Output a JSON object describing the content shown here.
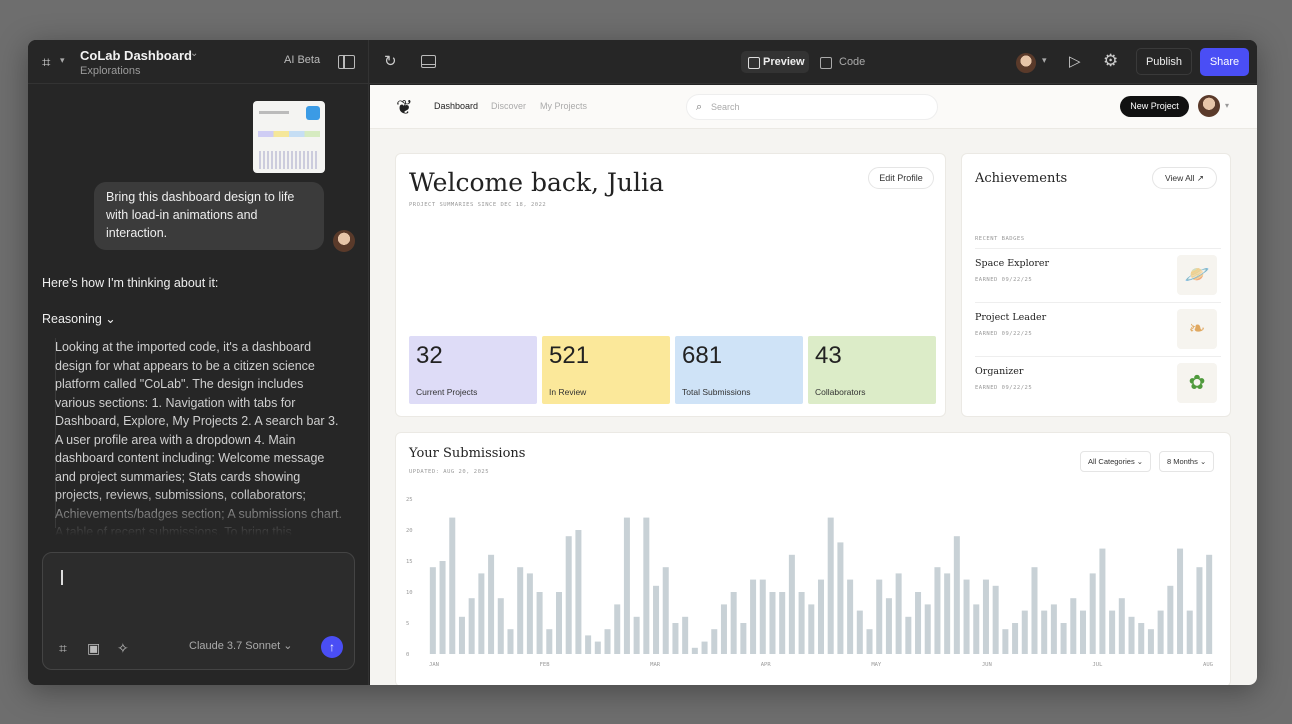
{
  "editor": {
    "title": "CoLab Dashboard",
    "subtitle": "Explorations",
    "ai_badge": "AI Beta"
  },
  "chat": {
    "user_message": "Bring this dashboard design to life with load-in animations and interaction.",
    "thinking_label": "Here's how I'm thinking about it:",
    "reasoning_label": "Reasoning",
    "reasoning_text": "Looking at the imported code, it's a dashboard design for what appears to be a citizen science platform called \"CoLab\". The design includes various sections: 1. Navigation with tabs for Dashboard, Explore, My Projects 2. A search bar 3. A user profile area with a dropdown 4. Main dashboard content including: Welcome message and project summaries; Stats cards showing projects, reviews, submissions, collaborators; Achievements/badges section; A submissions chart. A table of recent submissions. To bring this",
    "model": "Claude 3.7 Sonnet",
    "caret_down": "⌄"
  },
  "toolbar": {
    "preview": "Preview",
    "code": "Code",
    "publish": "Publish",
    "share": "Share"
  },
  "app": {
    "nav": {
      "tabs": [
        "Dashboard",
        "Discover",
        "My Projects"
      ],
      "search_placeholder": "Search",
      "new_project": "New Project"
    },
    "welcome": {
      "title": "Welcome back, Julia",
      "subtitle": "PROJECT SUMMARIES SINCE DEC 18, 2022",
      "edit_profile": "Edit Profile"
    },
    "stats": [
      {
        "value": "32",
        "label": "Current Projects",
        "color": "#dedcf7"
      },
      {
        "value": "521",
        "label": "In Review",
        "color": "#fbe89a"
      },
      {
        "value": "681",
        "label": "Total Submissions",
        "color": "#cfe3f7"
      },
      {
        "value": "43",
        "label": "Collaborators",
        "color": "#dcecc8"
      }
    ],
    "achievements": {
      "title": "Achievements",
      "view_all": "View All ↗",
      "recent_label": "RECENT BADGES",
      "badges": [
        {
          "name": "Space Explorer",
          "earned": "EARNED 09/22/25",
          "icon": "planet-icon"
        },
        {
          "name": "Project Leader",
          "earned": "EARNED 09/22/25",
          "icon": "leaf-icon"
        },
        {
          "name": "Organizer",
          "earned": "EARNED 09/22/25",
          "icon": "clover-icon"
        }
      ]
    },
    "submissions": {
      "title": "Your Submissions",
      "updated": "UPDATED: AUG 20, 2025",
      "category_select": "All Categories",
      "range_select": "8 Months"
    }
  },
  "chart_data": {
    "type": "bar",
    "ylim": [
      0,
      25
    ],
    "yticks": [
      "25",
      "20",
      "15",
      "10",
      "5",
      "0"
    ],
    "xticks": [
      "JAN",
      "FEB",
      "MAR",
      "APR",
      "MAY",
      "JUN",
      "JUL",
      "AUG"
    ],
    "color": "#c8d1d6",
    "values": [
      14,
      15,
      22,
      6,
      9,
      13,
      16,
      9,
      4,
      14,
      13,
      10,
      4,
      10,
      19,
      20,
      3,
      2,
      4,
      8,
      22,
      6,
      22,
      11,
      14,
      5,
      6,
      1,
      2,
      4,
      8,
      10,
      5,
      12,
      12,
      10,
      10,
      16,
      10,
      8,
      12,
      22,
      18,
      12,
      7,
      4,
      12,
      9,
      13,
      6,
      10,
      8,
      14,
      13,
      19,
      12,
      8,
      12,
      11,
      4,
      5,
      7,
      14,
      7,
      8,
      5,
      9,
      7,
      13,
      17,
      7,
      9,
      6,
      5,
      4,
      7,
      11,
      17,
      7,
      14,
      16
    ]
  },
  "colors": {
    "accent": "#4a4ef5",
    "dark_bg": "#262626"
  }
}
